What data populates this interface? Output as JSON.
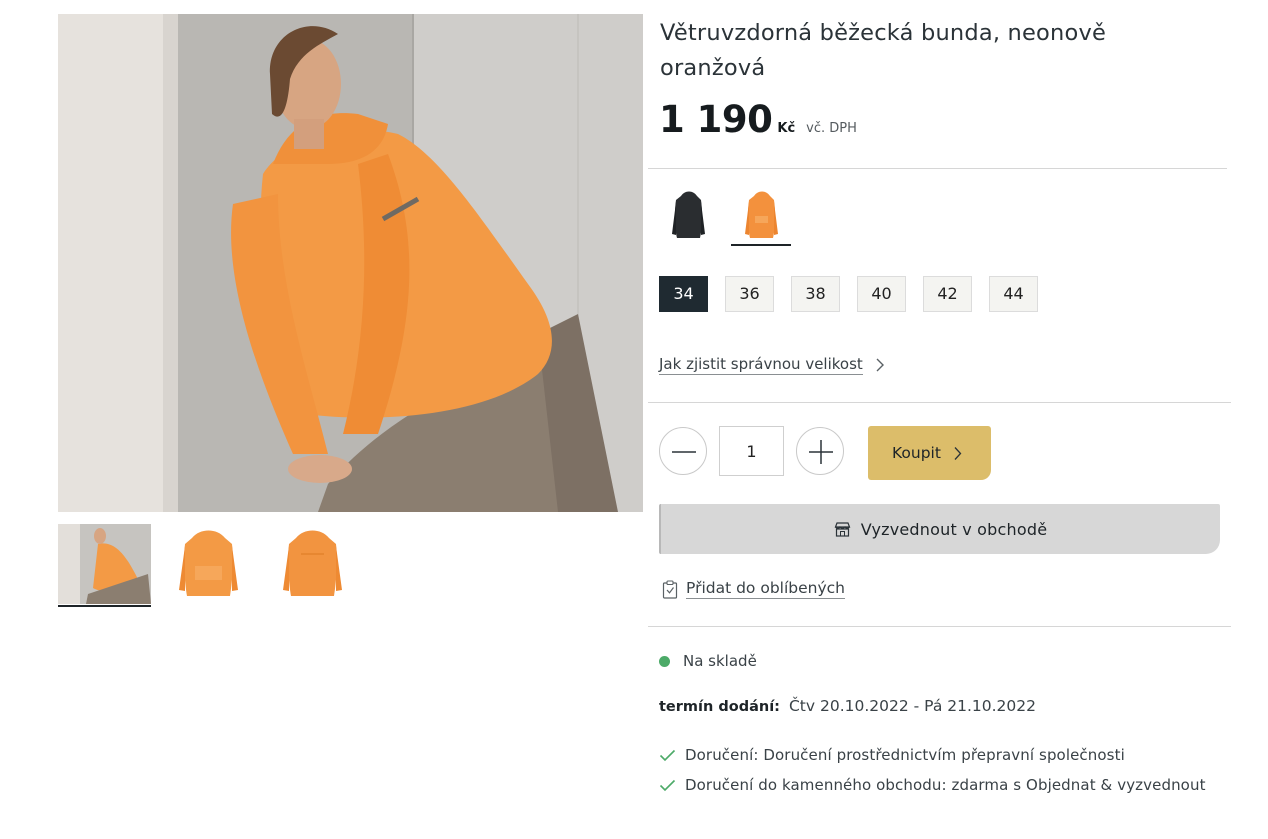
{
  "product": {
    "title": "Větruvzdorná běžecká bunda, neonově oranžová",
    "price": "1 190",
    "currency": "Kč",
    "vat_note": "vč. DPH"
  },
  "colors": [
    {
      "name": "black-jacket",
      "swatch": "#2a2d30",
      "selected": false
    },
    {
      "name": "orange-jacket",
      "swatch": "#f3913d",
      "selected": true
    }
  ],
  "sizes": {
    "options": [
      "34",
      "36",
      "38",
      "40",
      "42",
      "44"
    ],
    "selected": "34"
  },
  "size_guide_label": "Jak zjistit správnou velikost",
  "quantity": {
    "value": "1"
  },
  "buy_label": "Koupit",
  "pickup_label": "Vyzvednout v obchodě",
  "favorite_label": "Přidat do oblíbených",
  "stock": {
    "status": "Na skladě",
    "status_color": "#4caa68"
  },
  "delivery": {
    "term_label": "termín dodání:",
    "term_value": "Čtv 20.10.2022 - Pá 21.10.2022",
    "options": [
      "Doručení: Doručení prostřednictvím přepravní společnosti",
      "Doručení do kamenného obchodu: zdarma s Objednat & vyzvednout"
    ]
  },
  "colors_theme": {
    "accent_gold": "#dcbd6a",
    "selected_size_bg": "#1f2a31",
    "check_green": "#4caa68"
  },
  "icons": [
    "minus-icon",
    "plus-icon",
    "chevron-right-icon",
    "store-icon",
    "clipboard-heart-icon",
    "check-icon"
  ]
}
